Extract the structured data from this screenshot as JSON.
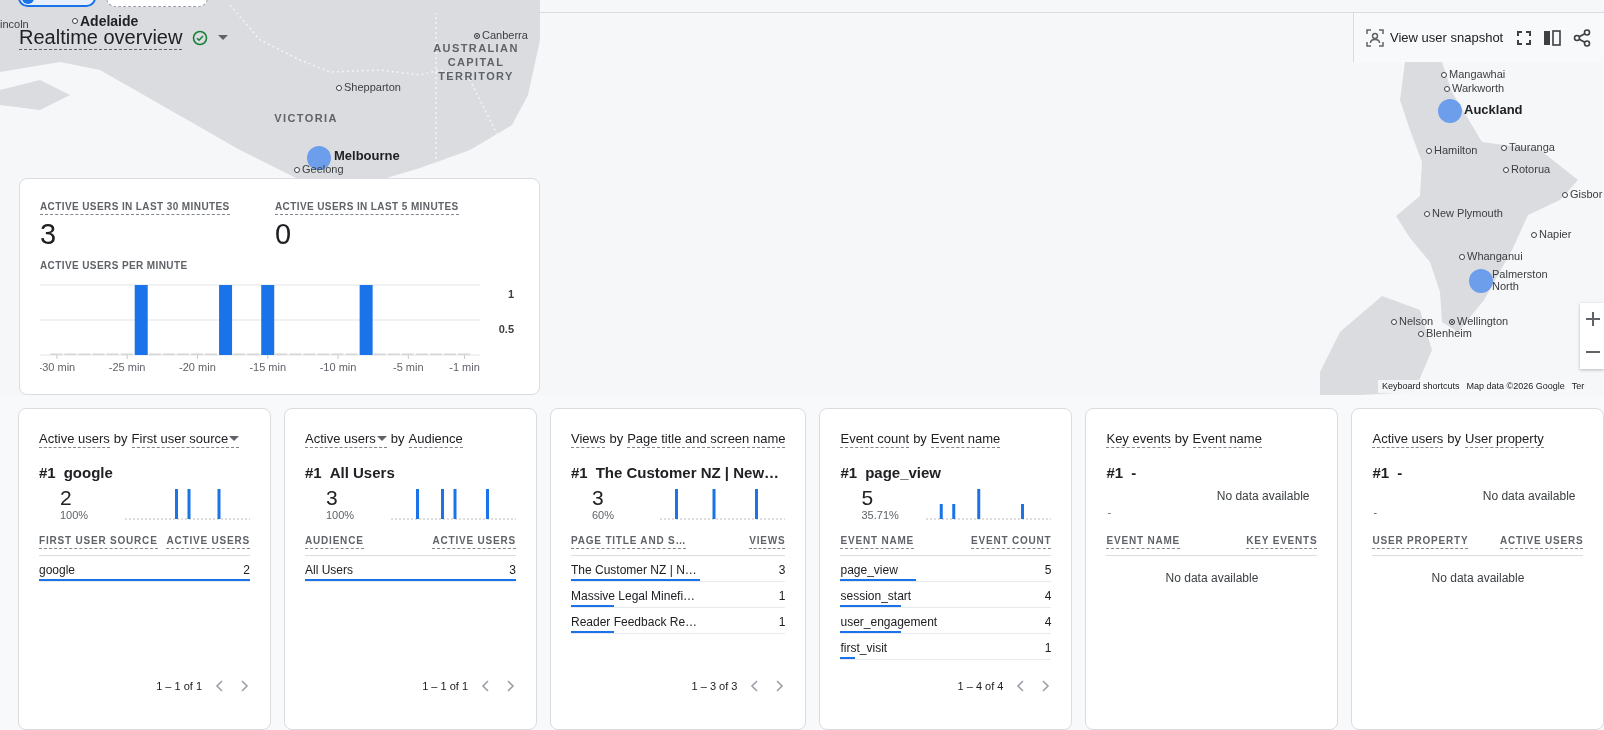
{
  "header": {
    "title": "Realtime overview",
    "verified": true,
    "snapshot_label": "View user snapshot"
  },
  "map": {
    "labels": [
      {
        "text": "incoln",
        "kind": "fragment"
      },
      {
        "text": "Adelaide",
        "kind": "major"
      },
      {
        "text": "Canberra",
        "kind": "capital"
      },
      {
        "text": "AUSTRALIAN CAPITAL TERRITORY",
        "kind": "region"
      },
      {
        "text": "Shepparton",
        "kind": "town"
      },
      {
        "text": "VICTORIA",
        "kind": "region"
      },
      {
        "text": "Melbourne",
        "kind": "city"
      },
      {
        "text": "Geelong",
        "kind": "town"
      },
      {
        "text": "Mangawhai",
        "kind": "town"
      },
      {
        "text": "Warkworth",
        "kind": "town"
      },
      {
        "text": "Auckland",
        "kind": "city"
      },
      {
        "text": "Hamilton",
        "kind": "town"
      },
      {
        "text": "Tauranga",
        "kind": "town"
      },
      {
        "text": "Rotorua",
        "kind": "town"
      },
      {
        "text": "Gisbor",
        "kind": "town"
      },
      {
        "text": "New Plymouth",
        "kind": "town"
      },
      {
        "text": "Napier",
        "kind": "town"
      },
      {
        "text": "Whanganui",
        "kind": "town"
      },
      {
        "text": "Palmerston North",
        "kind": "city"
      },
      {
        "text": "Nelson",
        "kind": "town"
      },
      {
        "text": "Wellington",
        "kind": "capital"
      },
      {
        "text": "Blenheim",
        "kind": "town"
      }
    ],
    "attribution": [
      "Keyboard shortcuts",
      "Map data ©2026 Google",
      "Ter"
    ]
  },
  "summary": {
    "metrics": [
      {
        "label": "ACTIVE USERS IN LAST 30 MINUTES",
        "value": "3"
      },
      {
        "label": "ACTIVE USERS IN LAST 5 MINUTES",
        "value": "0"
      }
    ],
    "chart_title": "ACTIVE USERS PER MINUTE",
    "chart_data": {
      "type": "bar",
      "x": [
        -30,
        -29,
        -28,
        -27,
        -26,
        -25,
        -24,
        -23,
        -22,
        -21,
        -20,
        -19,
        -18,
        -17,
        -16,
        -15,
        -14,
        -13,
        -12,
        -11,
        -10,
        -9,
        -8,
        -7,
        -6,
        -5,
        -4,
        -3,
        -2,
        -1
      ],
      "values": [
        0,
        0,
        0,
        0,
        0,
        0,
        1,
        0,
        0,
        0,
        0,
        0,
        1,
        0,
        0,
        1,
        0,
        0,
        0,
        0,
        0,
        0,
        1,
        0,
        0,
        0,
        0,
        0,
        0,
        0
      ],
      "xticks": [
        {
          "value": -30,
          "label": "-30 min"
        },
        {
          "value": -25,
          "label": "-25 min"
        },
        {
          "value": -20,
          "label": "-20 min"
        },
        {
          "value": -15,
          "label": "-15 min"
        },
        {
          "value": -10,
          "label": "-10 min"
        },
        {
          "value": -5,
          "label": "-5 min"
        },
        {
          "value": -1,
          "label": "-1 min"
        }
      ],
      "xlim": [
        -31.2,
        0.1
      ],
      "ylim": [
        0,
        1
      ],
      "yticks": [
        0.5,
        1
      ]
    }
  },
  "cards": [
    {
      "kind": "table",
      "title": {
        "metric": "Active users",
        "metric_dropdown": false,
        "joiner": "by",
        "dimension": "First user source",
        "dimension_dropdown": true
      },
      "rank": "#1",
      "top_item": "google",
      "value": "2",
      "share": "100%",
      "columns": [
        "FIRST USER SOURCE",
        "ACTIVE USERS"
      ],
      "rows": [
        {
          "label": "google",
          "value": "2",
          "level": 1
        }
      ],
      "pagination": "1 – 1 of 1"
    },
    {
      "kind": "table",
      "title": {
        "metric": "Active users",
        "metric_dropdown": true,
        "joiner": "by",
        "dimension": "Audience",
        "dimension_dropdown": false
      },
      "rank": "#1",
      "top_item": "All Users",
      "value": "3",
      "share": "100%",
      "columns": [
        "AUDIENCE",
        "ACTIVE USERS"
      ],
      "rows": [
        {
          "label": "All Users",
          "value": "3",
          "level": 1
        }
      ],
      "pagination": "1 – 1 of 1"
    },
    {
      "kind": "table",
      "title": {
        "metric": "Views",
        "metric_dropdown": false,
        "joiner": "by",
        "dimension": "Page title and screen name",
        "dimension_dropdown": false
      },
      "rank": "#1",
      "top_item": "The Customer NZ | New…",
      "value": "3",
      "share": "60%",
      "columns": [
        "PAGE TITLE AND S…",
        "VIEWS"
      ],
      "rows": [
        {
          "label": "The Customer NZ | N…",
          "value": "3",
          "level": 0.6
        },
        {
          "label": "Massive Legal Minefi…",
          "value": "1",
          "level": 0.2
        },
        {
          "label": "Reader Feedback Re…",
          "value": "1",
          "level": 0.2
        }
      ],
      "pagination": "1 – 3 of 3"
    },
    {
      "kind": "table",
      "title": {
        "metric": "Event count",
        "metric_dropdown": false,
        "joiner": "by",
        "dimension": "Event name",
        "dimension_dropdown": false
      },
      "rank": "#1",
      "top_item": "page_view",
      "value": "5",
      "share": "35.71%",
      "columns": [
        "EVENT NAME",
        "EVENT COUNT"
      ],
      "rows": [
        {
          "label": "page_view",
          "value": "5",
          "level": 0.357
        },
        {
          "label": "session_start",
          "value": "4",
          "level": 0.286
        },
        {
          "label": "user_engagement",
          "value": "4",
          "level": 0.286
        },
        {
          "label": "first_visit",
          "value": "1",
          "level": 0.071
        }
      ],
      "pagination": "1 – 4 of 4"
    },
    {
      "kind": "empty",
      "title": {
        "metric": "Key events",
        "metric_dropdown": false,
        "joiner": "by",
        "dimension": "Event name",
        "dimension_dropdown": false
      },
      "rank": "#1",
      "top_item": "-",
      "value": "-",
      "chart_message": "No data available",
      "columns": [
        "EVENT NAME",
        "KEY EVENTS"
      ],
      "empty_message": "No data available"
    },
    {
      "kind": "empty",
      "title": {
        "metric": "Active users",
        "metric_dropdown": false,
        "joiner": "by",
        "dimension": "User property",
        "dimension_dropdown": false
      },
      "rank": "#1",
      "top_item": "-",
      "value": "-",
      "chart_message": "No data available",
      "columns": [
        "USER PROPERTY",
        "ACTIVE USERS"
      ],
      "empty_message": "No data available"
    }
  ]
}
